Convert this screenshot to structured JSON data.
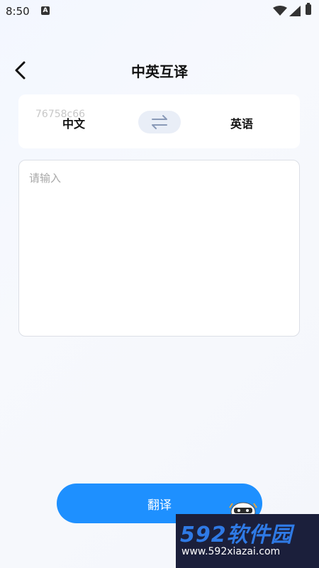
{
  "status_bar": {
    "time": "8:50",
    "notification_icon": "A"
  },
  "header": {
    "title": "中英互译"
  },
  "languages": {
    "source": "中文",
    "target": "英语",
    "overlay_text": "76758c66"
  },
  "input": {
    "placeholder": "请输入",
    "value": ""
  },
  "action": {
    "translate_label": "翻译"
  },
  "watermark": {
    "brand": "592软件园",
    "url": "www.592xiazai.com"
  },
  "colors": {
    "accent": "#1e90ff",
    "swap_bg": "#e9eef7"
  }
}
